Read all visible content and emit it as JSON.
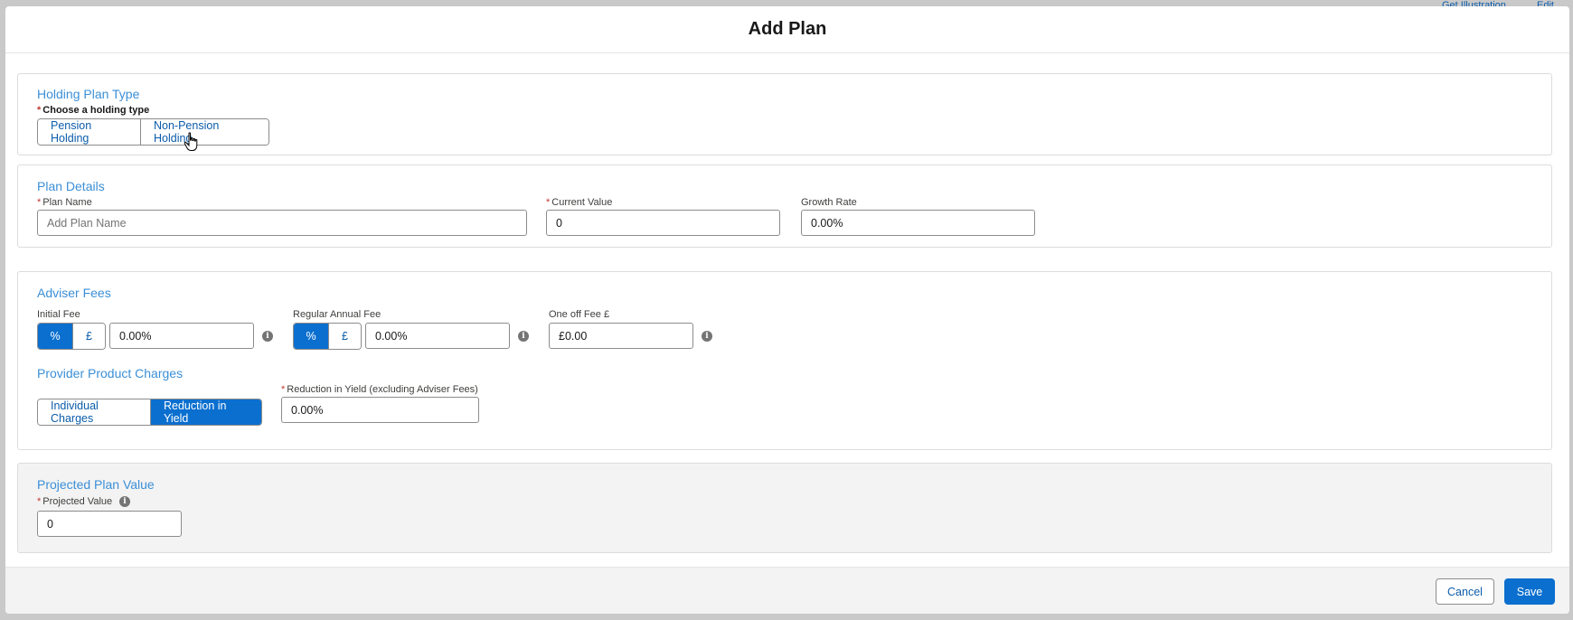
{
  "background": {
    "links": [
      "Get Illustration",
      "Edit"
    ]
  },
  "modal": {
    "title": "Add Plan"
  },
  "holding_plan_type": {
    "title": "Holding Plan Type",
    "label": "Choose a holding type",
    "options": [
      "Pension Holding",
      "Non-Pension Holding"
    ]
  },
  "plan_details": {
    "title": "Plan Details",
    "plan_name_label": "Plan Name",
    "plan_name_placeholder": "Add Plan Name",
    "plan_name_value": "",
    "current_value_label": "Current Value",
    "current_value": "0",
    "growth_rate_label": "Growth Rate",
    "growth_rate": "0.00%"
  },
  "adviser_fees": {
    "title": "Adviser Fees",
    "initial_fee_label": "Initial Fee",
    "initial_fee_toggle": [
      "%",
      "£"
    ],
    "initial_fee_value": "0.00%",
    "regular_fee_label": "Regular Annual Fee",
    "regular_fee_toggle": [
      "%",
      "£"
    ],
    "regular_fee_value": "0.00%",
    "one_off_label": "One off Fee £",
    "one_off_value": "£0.00",
    "info_glyph": "i"
  },
  "provider_charges": {
    "title": "Provider Product Charges",
    "options": [
      "Individual Charges",
      "Reduction in Yield"
    ],
    "reduction_label": "Reduction in Yield (excluding Adviser Fees)",
    "reduction_value": "0.00%"
  },
  "projected": {
    "title": "Projected Plan Value",
    "label": "Projected Value",
    "value": "0"
  },
  "footer": {
    "cancel": "Cancel",
    "save": "Save"
  },
  "colors": {
    "brand": "#0b6fcf",
    "section_title": "#3b8fd7",
    "required": "#c23934"
  }
}
